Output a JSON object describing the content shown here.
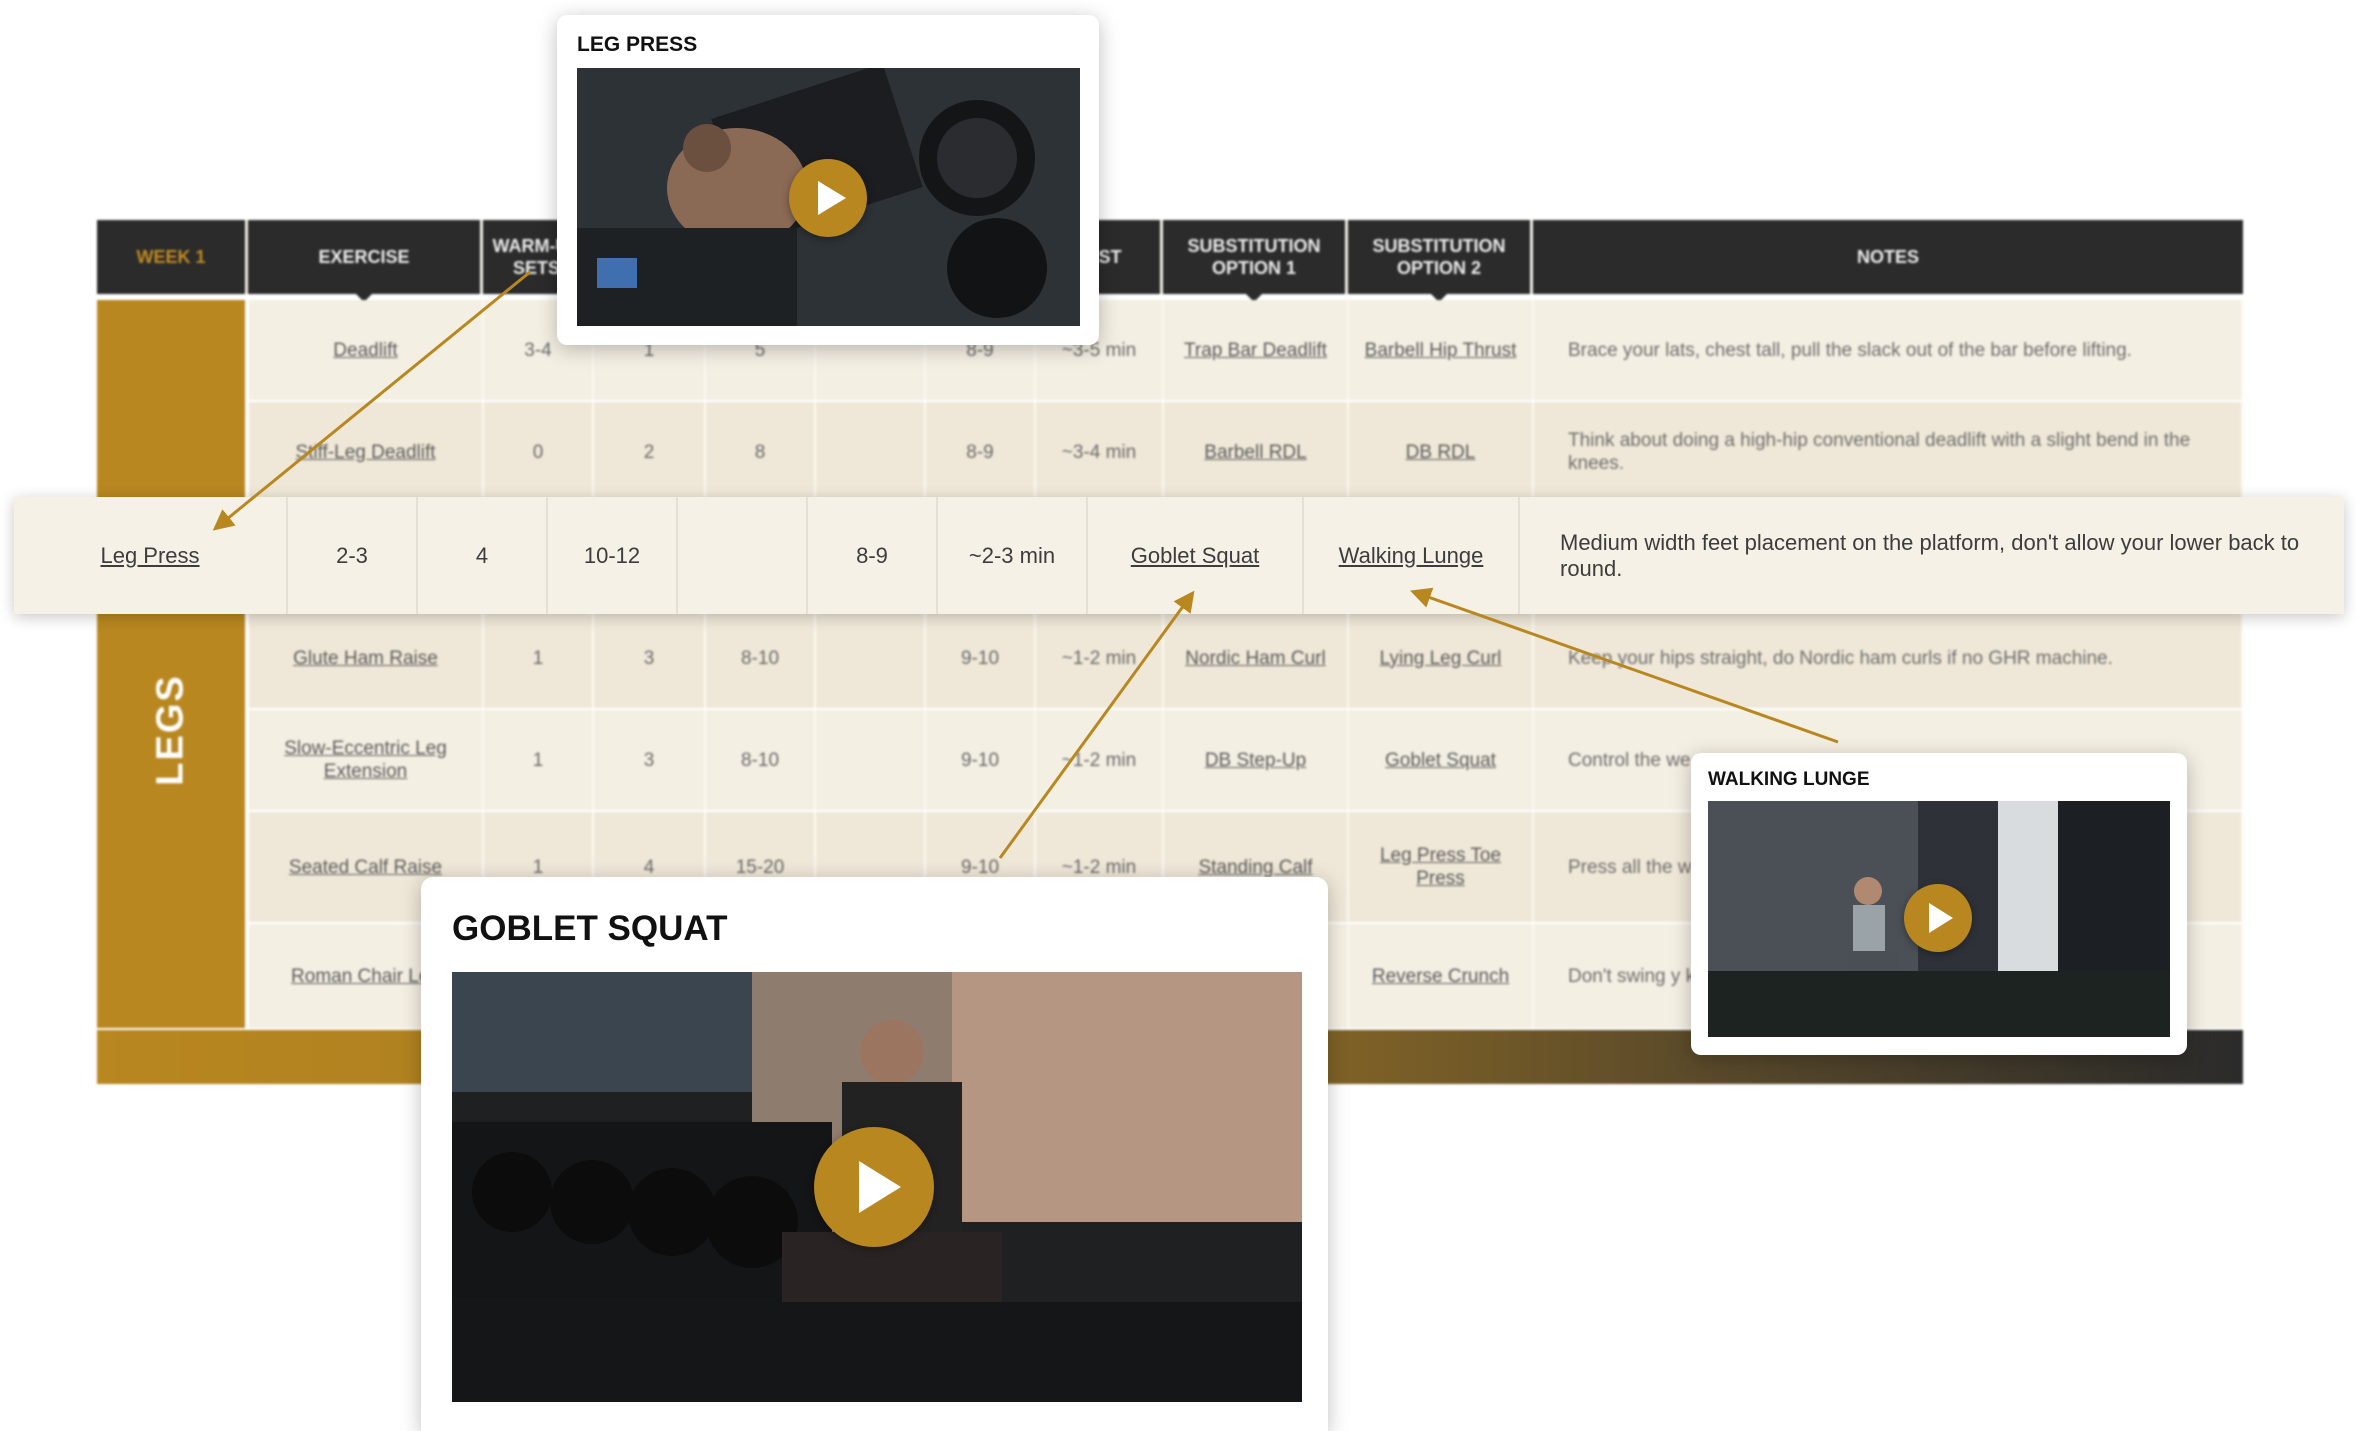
{
  "table": {
    "headers": {
      "week": "WEEK 1",
      "exercise": "EXERCISE",
      "warmup": "WARM-UP SETS",
      "rest": "REST",
      "sub1": "SUBSTITUTION OPTION 1",
      "sub2": "SUBSTITUTION OPTION 2",
      "notes": "NOTES"
    },
    "section_label": "LEGS",
    "rows": [
      {
        "exercise": "Deadlift",
        "warmup": "3-4",
        "sets": "1",
        "reps": "5",
        "rpe": "8-9",
        "rest": "~3-5 min",
        "sub1": "Trap Bar Deadlift",
        "sub2": "Barbell Hip Thrust",
        "notes": "Brace your lats, chest tall, pull the slack out of the bar before lifting."
      },
      {
        "exercise": "Stiff-Leg Deadlift",
        "warmup": "0",
        "sets": "2",
        "reps": "8",
        "rpe": "8-9",
        "rest": "~3-4 min",
        "sub1": "Barbell RDL",
        "sub2": "DB RDL",
        "notes": "Think about doing a high-hip conventional deadlift with a slight bend in the knees."
      },
      {
        "exercise": "Glute Ham Raise",
        "warmup": "1",
        "sets": "3",
        "reps": "8-10",
        "rpe": "9-10",
        "rest": "~1-2 min",
        "sub1": "Nordic Ham Curl",
        "sub2": "Lying Leg Curl",
        "notes": "Keep your hips straight, do Nordic ham curls if no GHR machine."
      },
      {
        "exercise": "Slow-Eccentric Leg Extension",
        "warmup": "1",
        "sets": "3",
        "reps": "8-10",
        "rpe": "9-10",
        "rest": "~1-2 min",
        "sub1": "DB Step-Up",
        "sub2": "Goblet Squat",
        "notes": "Control the we"
      },
      {
        "exercise": "Seated Calf Raise",
        "warmup": "1",
        "sets": "4",
        "reps": "15-20",
        "rpe": "9-10",
        "rest": "~1-2 min",
        "sub1": "Standing Calf",
        "sub2": "Leg Press Toe Press",
        "notes": "Press all the w bounce."
      },
      {
        "exercise": "Roman Chair Leg",
        "warmup": "",
        "sets": "",
        "reps": "",
        "rpe": "",
        "rest": "",
        "sub1": "",
        "sub2": "Reverse Crunch",
        "notes": "Don't swing y knees toward"
      }
    ]
  },
  "focus_row": {
    "exercise": "Leg Press",
    "warmup": "2-3",
    "sets": "4",
    "reps": "10-12",
    "extra": "",
    "rpe": "8-9",
    "rest": "~2-3 min",
    "sub1": "Goblet Squat",
    "sub2": "Walking Lunge",
    "notes": "Medium width feet placement on the platform, don't allow your lower back to round."
  },
  "cards": {
    "leg_press": {
      "title": "LEG PRESS"
    },
    "walking_lunge": {
      "title": "WALKING LUNGE"
    },
    "goblet_squat": {
      "title": "GOBLET SQUAT"
    }
  },
  "colors": {
    "accent": "#b88720",
    "header_dark": "#2b2b2b",
    "row_bg": "#f4efe3"
  },
  "icons": {
    "play": "play-icon"
  }
}
